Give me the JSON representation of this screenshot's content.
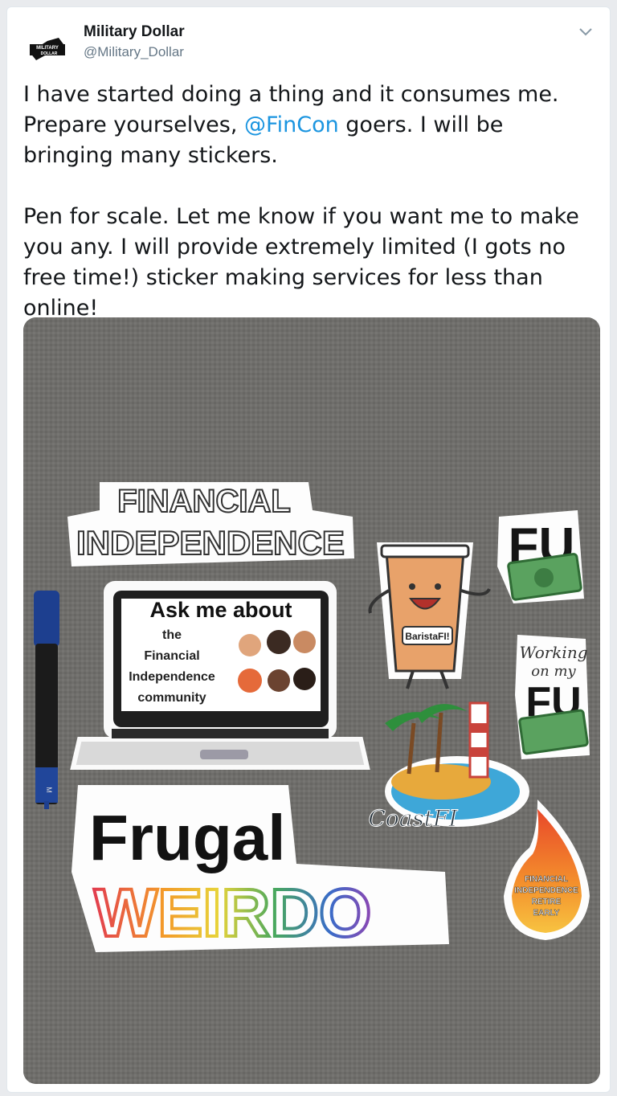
{
  "author": {
    "name": "Military Dollar",
    "handle": "@Military_Dollar",
    "avatar_text": [
      "MILITARY",
      "DOLLAR"
    ]
  },
  "tweet": {
    "p1_before": "I have started doing a thing and it consumes me. Prepare yourselves, ",
    "mention": "@FinCon",
    "p1_after": " goers. I will be bringing many stickers.",
    "p2": "Pen for scale. Let me know if you want me to make you any. I will provide extremely limited (I gots no free time!) sticker making services for less than online!"
  },
  "photo": {
    "stickers": {
      "fi_line1": "FINANCIAL",
      "fi_line2": "INDEPENDENCE",
      "ask_title": "Ask me about",
      "ask_lines": [
        "the",
        "Financial",
        "Independence",
        "community"
      ],
      "barista": "BaristaFI!",
      "fu": "FU",
      "working_line1": "Working",
      "working_line2": "on my",
      "working_fu": "FU",
      "coast": "CoastFI",
      "frugal": "Frugal",
      "weirdo": "WEIRDO",
      "fire_lines": [
        "FINANCIAL",
        "INDEPENDENCE",
        "RETIRE",
        "EARLY"
      ]
    },
    "pen_text": "M"
  },
  "colors": {
    "link": "#1b95e0",
    "text": "#14171a",
    "muted": "#657786",
    "fabric": "#6f6e6b"
  }
}
